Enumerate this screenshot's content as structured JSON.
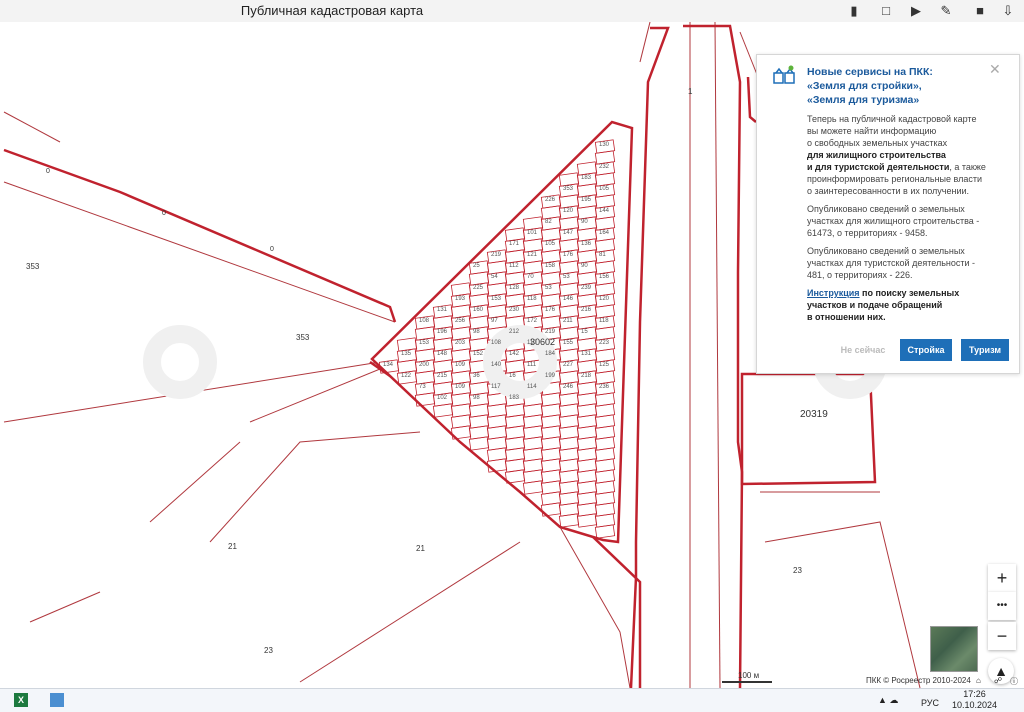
{
  "window": {
    "title": "Публичная кадастровая карта"
  },
  "map": {
    "labels": {
      "quarter": "30602",
      "zone_20319": "20319",
      "r1": "1",
      "z353a": "353",
      "z353b": "353",
      "z21a": "21",
      "z21b": "21",
      "z23a": "23",
      "z23b": "23",
      "small_0a": "0",
      "small_0b": "0",
      "small_0c": "0"
    },
    "parcel_numbers": [
      "130",
      "232",
      "183",
      "353",
      "105",
      "226",
      "195",
      "120",
      "144",
      "82",
      "90",
      "101",
      "147",
      "164",
      "171",
      "105",
      "136",
      "219",
      "121",
      "176",
      "81",
      "25",
      "112",
      "158",
      "90",
      "54",
      "70",
      "53",
      "156",
      "225",
      "128",
      "53",
      "239",
      "193",
      "153",
      "118",
      "146",
      "120",
      "131",
      "160",
      "230",
      "176",
      "216",
      "108",
      "256",
      "97",
      "172",
      "211",
      "118",
      "196",
      "98",
      "212",
      "219",
      "15",
      "153",
      "203",
      "108",
      "110",
      "155",
      "223",
      "135",
      "148",
      "152",
      "142",
      "184",
      "131",
      "134",
      "200",
      "109",
      "140",
      "111",
      "227",
      "125",
      "122",
      "215",
      "36",
      "16",
      "199",
      "218",
      "73",
      "109",
      "117",
      "114",
      "246",
      "236",
      "102",
      "98",
      "183"
    ],
    "scale": "100 м",
    "copyright": "ПКК © Росреестр 2010-2024"
  },
  "popup": {
    "title_line1": "Новые сервисы на ПКК:",
    "title_line2": "«Земля для стройки»,",
    "title_line3": "«Земля для туризма»",
    "p1_a": "Теперь на публичной кадастровой карте",
    "p1_b": "вы можете найти информацию",
    "p1_c": "о свободных земельных участках",
    "p1_d": "для жилищного строительства",
    "p1_e_bold": "и для туристской деятельности",
    "p1_e_rest": ", а также",
    "p1_f": "проинформировать региональные власти",
    "p1_g": "о заинтересованности в их получении.",
    "p2_a": "Опубликовано сведений о земельных",
    "p2_b": "участках для жилищного строительства -",
    "p2_c": "61473, о территориях - 9458.",
    "p3_a": "Опубликовано сведений о земельных",
    "p3_b": "участках для туристской деятельности -",
    "p3_c": "481, о территориях - 226.",
    "link": "Инструкция",
    "p4_a_rest": " по поиску земельных",
    "p4_b": "участков и подаче обращений",
    "p4_c": "в отношении них.",
    "btn_later": "Не сейчас",
    "btn_build": "Стройка",
    "btn_tourism": "Туризм"
  },
  "controls": {
    "zoom_in": "+",
    "more": "•••",
    "zoom_out": "−"
  },
  "taskbar": {
    "lang": "РУС",
    "time": "17:26",
    "date": "10.10.2024"
  }
}
